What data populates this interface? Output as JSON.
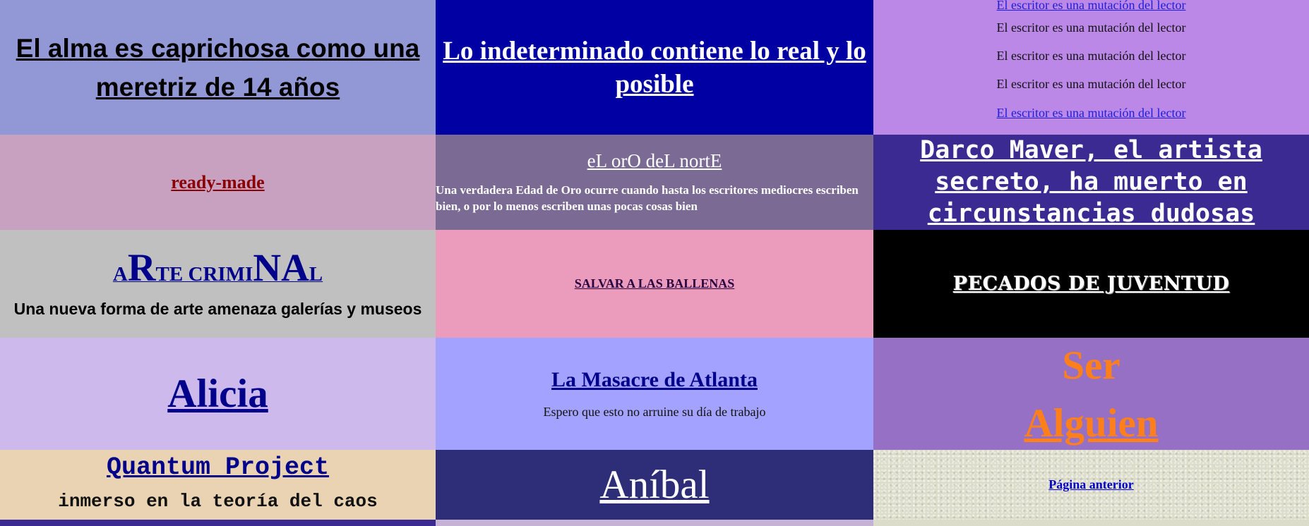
{
  "cells": {
    "alma": "El alma es caprichosa como una meretriz de 14 años",
    "indeterminado": "Lo indeterminado contiene lo real y lo posible",
    "escritor_lines": [
      "El escritor es una mutación del lector",
      "El escritor es una mutación del lector",
      "El escritor es una mutación del lector",
      "El escritor es una mutación del lector",
      "El escritor es una mutación del lector"
    ],
    "ready_made": "ready-made",
    "oro_title": "eL orO deL nortE",
    "oro_sub": "Una verdadera Edad de Oro ocurre cuando hasta los escritores mediocres escriben bien, o por lo menos escriben unas pocas cosas bien",
    "darco": "Darco Maver, el artista secreto, ha muerto en circunstancias dudosas",
    "arte_criminal": {
      "p1": "A",
      "p2": "R",
      "p3": "TE C",
      "p4": "R",
      "p5": "IMI",
      "p6": "NA",
      "p7": "L"
    },
    "arte_sub": "Una nueva forma de arte amenaza galerías y museos",
    "ballenas": "SALVAR A LAS BALLENAS",
    "pecados": "PECADOS DE JUVENTUD",
    "alicia": "Alicia",
    "masacre": "La Masacre de Atlanta",
    "masacre_sub": "Espero que esto no arruine su día de trabajo",
    "ser": "Ser",
    "alguien": "Alguien",
    "quantum": "Quantum Project",
    "quantum_sub": "inmerso en la teoría del caos",
    "anibal": "Aníbal",
    "pagina_anterior": "Página anterior"
  },
  "colors": {
    "link_blue": "#1e1ed8",
    "dark_navy": "#00008b",
    "orange": "#ff7f1a"
  }
}
